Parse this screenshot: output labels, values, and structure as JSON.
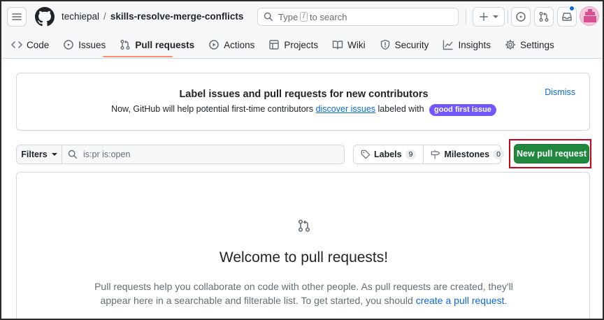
{
  "header": {
    "owner": "techiepal",
    "separator": "/",
    "repo": "skills-resolve-merge-conflicts",
    "search_prefix": "Type",
    "search_key": "/",
    "search_suffix": "to search"
  },
  "tabs": [
    {
      "label": "Code",
      "icon": "code-icon"
    },
    {
      "label": "Issues",
      "icon": "issue-opened-icon"
    },
    {
      "label": "Pull requests",
      "icon": "git-pull-request-icon",
      "selected": true
    },
    {
      "label": "Actions",
      "icon": "play-icon"
    },
    {
      "label": "Projects",
      "icon": "table-icon"
    },
    {
      "label": "Wiki",
      "icon": "book-icon"
    },
    {
      "label": "Security",
      "icon": "shield-icon"
    },
    {
      "label": "Insights",
      "icon": "graph-icon"
    },
    {
      "label": "Settings",
      "icon": "gear-icon"
    }
  ],
  "banner": {
    "title": "Label issues and pull requests for new contributors",
    "text_before": "Now, GitHub will help potential first-time contributors",
    "link": "discover issues",
    "text_after": "labeled with",
    "label": "good first issue",
    "label_color": "#7057ff",
    "dismiss": "Dismiss"
  },
  "filters": {
    "button": "Filters",
    "query": "is:pr is:open",
    "labels_label": "Labels",
    "labels_count": "9",
    "milestones_label": "Milestones",
    "milestones_count": "0",
    "new_pr": "New pull request"
  },
  "blankslate": {
    "title": "Welcome to pull requests!",
    "text": "Pull requests help you collaborate on code with other people. As pull requests are created, they'll appear here in a searchable and filterable list. To get started, you should",
    "link": "create a pull request",
    "end": "."
  },
  "colors": {
    "primary_button": "#1f883d",
    "link": "#0969da",
    "tab_underline": "#fd8c73",
    "highlight": "#d0021b"
  }
}
